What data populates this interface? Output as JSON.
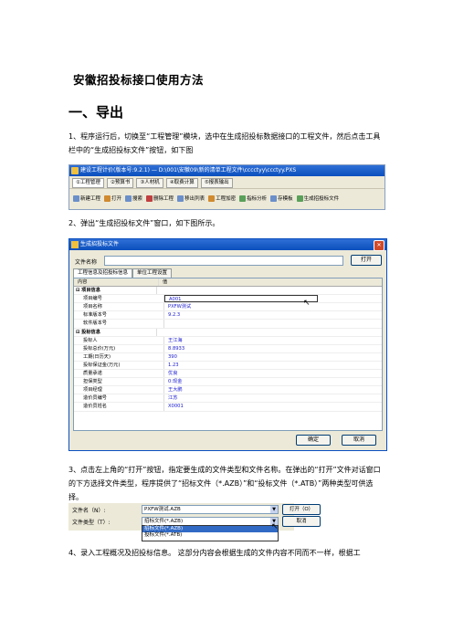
{
  "doc": {
    "title": "安徽招投标接口使用方法",
    "heading": "一、导出",
    "p1": "1、程序运行后，切换至“工程管理”模块，选中在生成招投标数据接口的工程文件，然后点击工具栏中的“生成招投标文件”按钮，如下图",
    "p2": "2、弹出“生成招投标文件”窗口，如下图所示。",
    "p3": "3、点击左上角的“打开”按钮，指定要生成的文件类型和文件名称。在弹出的“打开”文件对话窗口的下方选择文件类型，程序提供了“招标文件（*.AZB）”和“投标文件（*.ATB）”两种类型可供选择。",
    "p4": "4、录入工程概况及招投标信息。 这部分内容会根据生成的文件内容不同而不一样，根据工"
  },
  "shot1": {
    "title": "建设工程计价(版本号:9.2.1) — D:\\001\\安徽09\\新的清单工程文件\\cccctyy\\ccctyy.PXS",
    "tabs": [
      "①工程管理",
      "②预算书",
      "③人材机",
      "④取费计算",
      "⑤报表输出"
    ],
    "toolbar": [
      "新建工程",
      "打开",
      "搜索",
      "删除工程",
      "移出列表",
      "工程加密",
      "指标分析",
      "存模板",
      "生成招投标文件"
    ]
  },
  "dialog": {
    "title": "生成招投标文件",
    "file_label": "文件名称",
    "open_btn": "打开",
    "tabs": [
      "工程信息及招投标信息",
      "单位工程设置"
    ],
    "col_name": "内容",
    "col_value": "值",
    "group1": "项目信息",
    "group2": "投标信息",
    "rows1": [
      {
        "name": "项目编号",
        "value": "A001"
      },
      {
        "name": "项目名称",
        "value": "PXFW测试"
      },
      {
        "name": "标准版本号",
        "value": "9.2.3"
      },
      {
        "name": "软件版本号",
        "value": ""
      }
    ],
    "rows2": [
      {
        "name": "投标人",
        "value": "王江海"
      },
      {
        "name": "投标总价(万元)",
        "value": "8.8933"
      },
      {
        "name": "工期(日历天)",
        "value": "390"
      },
      {
        "name": "投标保证金(万元)",
        "value": "1.23"
      },
      {
        "name": "质量承诺",
        "value": "优良"
      },
      {
        "name": "担保类型",
        "value": "0:现金"
      },
      {
        "name": "项目经理",
        "value": "王大鹏"
      },
      {
        "name": "造价员编号",
        "value": "江苏"
      },
      {
        "name": "造价员姓名",
        "value": "X0001"
      }
    ],
    "ok_btn": "确定",
    "cancel_btn": "取消"
  },
  "shot3": {
    "fname_label": "文件名（N）:",
    "fname_value": "PXFW测试.AZB",
    "ftype_label": "文件类型（T）:",
    "ftype_value": "招标文件(*.AZB)",
    "open_btn": "打开（O）",
    "cancel_btn": "取消",
    "options": [
      "招标文件(*.AZB)",
      "投标文件(*.ATB)"
    ]
  }
}
